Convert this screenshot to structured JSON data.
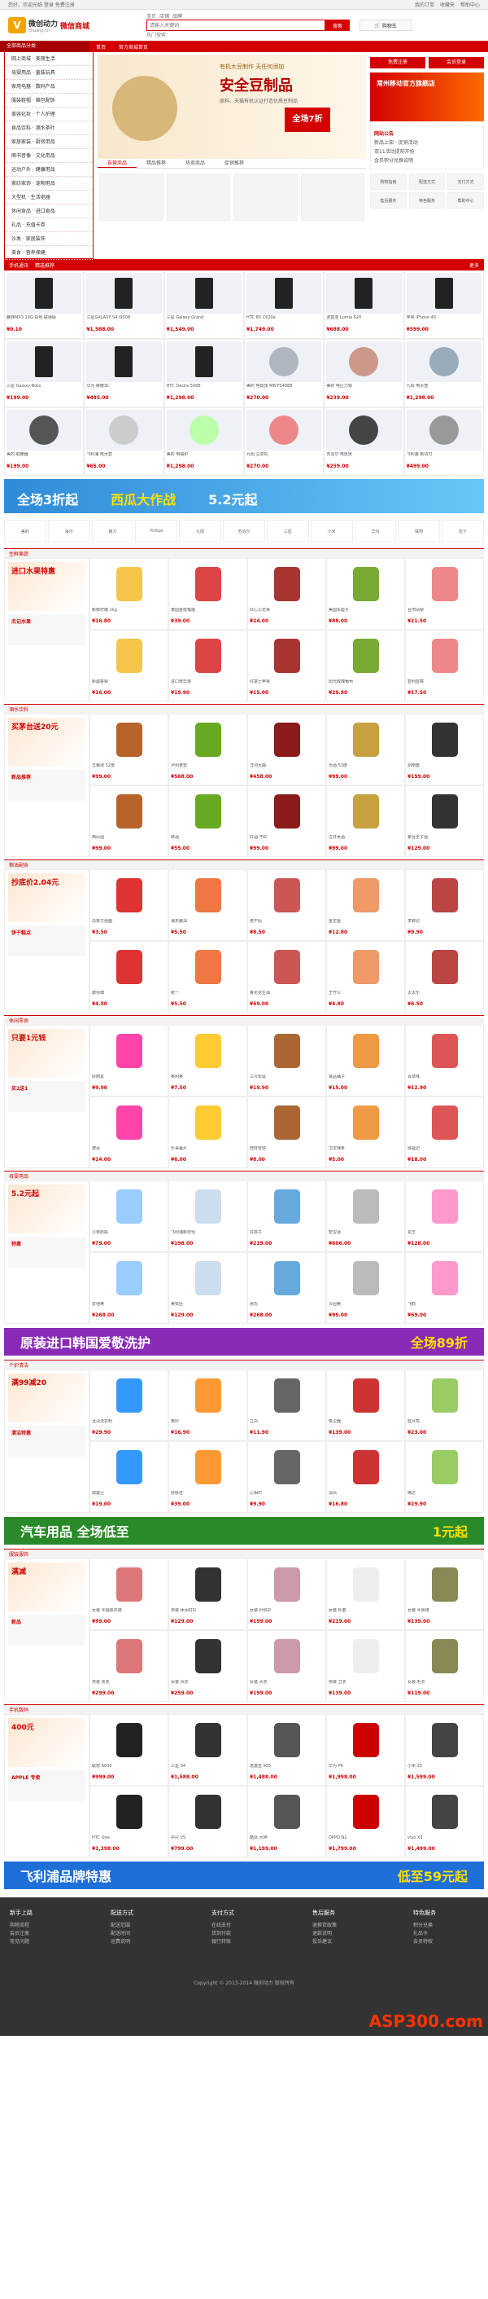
{
  "topbar": {
    "welcome": "您好，欢迎光临",
    "login": "登录",
    "register": "免费注册",
    "links": [
      "我的订单",
      "收藏夹",
      "帮助中心"
    ]
  },
  "header": {
    "logo": "微创动力",
    "sub": "微信商城",
    "domain": "chuang.cn",
    "search_tabs": [
      "宝贝",
      "店铺",
      "品牌"
    ],
    "search_placeholder": "请输入关键词",
    "search_button": "搜索",
    "hot": "热门搜索：",
    "cart": "购物车"
  },
  "nav": {
    "category": "全部商品分类",
    "links": [
      "首页",
      "官方商城首页"
    ]
  },
  "categories": [
    "网上商城 · 美丽生活",
    "母婴用品 · 童装玩具",
    "家用电器 · 数码产品",
    "服装鞋帽 · 箱包配饰",
    "美容化妆 · 个人护理",
    "食品饮料 · 酒水茶叶",
    "家居家装 · 厨房用品",
    "图书音像 · 文化用品",
    "运动户外 · 健康用品",
    "家纺家饰 · 宠物用品",
    "大型机 · 生活电器",
    "休闲食品 · 进口食品",
    "礼品 · 充值卡券",
    "沙发 · 家居装饰",
    "美食 · 营养保健"
  ],
  "banner": {
    "line1": "有机大豆制作 无任何添加",
    "title": "安全豆制品",
    "line3": "原料、天猫有机认证打造优质豆制品",
    "badge": "全场7折"
  },
  "minitabs": [
    "自营商品",
    "精品推荐",
    "热卖商品",
    "促销推荐"
  ],
  "right": {
    "btn1": "免费注册",
    "btn2": "会员登录",
    "promo": "常州移动官方旗舰店",
    "notice": [
      "网站公告",
      "新品上架 · 促销活动",
      "双11活动提前开抢",
      "会员积分兑换说明"
    ],
    "q": [
      "购物指南",
      "配送方式",
      "支付方式",
      "售后服务",
      "特色服务",
      "帮助中心"
    ]
  },
  "sec1": {
    "title": "手机通讯",
    "tabs": [
      "精选推荐"
    ],
    "more": "更多"
  },
  "products": [
    {
      "name": "魅族MX3 16G 白色 联通版",
      "price": "¥0.10"
    },
    {
      "name": "三星GALAXY S4 I9508",
      "price": "¥1,588.00"
    },
    {
      "name": "三星 Galaxy Grand",
      "price": "¥1,549.00"
    },
    {
      "name": "HTC 8X C620e",
      "price": "¥1,749.00"
    },
    {
      "name": "诺基亚 Lumia 620",
      "price": "¥688.00"
    },
    {
      "name": "苹果 iPhone 4S",
      "price": "¥599.00"
    },
    {
      "name": "三星 Galaxy Note",
      "price": "¥199.00"
    },
    {
      "name": "华为 荣耀3C",
      "price": "¥495.00"
    },
    {
      "name": "HTC Desire 5088",
      "price": "¥1,298.00"
    },
    {
      "name": "美的 电饭煲 MB-FS4088",
      "price": "¥270.00"
    },
    {
      "name": "美的 电压力锅",
      "price": "¥239.00"
    },
    {
      "name": "九阳 电水壶",
      "price": "¥1,298.00"
    },
    {
      "name": "美的 取暖器",
      "price": "¥199.00"
    },
    {
      "name": "飞利浦 电水壶",
      "price": "¥65.00"
    },
    {
      "name": "美的 电磁炉",
      "price": "¥1,298.00"
    },
    {
      "name": "九阳 豆浆机",
      "price": "¥270.00"
    },
    {
      "name": "苏泊尔 电饭煲",
      "price": "¥259.00"
    },
    {
      "name": "飞利浦 剃须刀",
      "price": "¥499.00"
    }
  ],
  "banner2": {
    "a": "全场3折起",
    "b": "西瓜大作战",
    "c": "5.2元起"
  },
  "brands": [
    "美的",
    "海尔",
    "格力",
    "Philips",
    "九阳",
    "苏泊尔",
    "三星",
    "小米",
    "华为",
    "联想",
    "松下"
  ],
  "fruit": {
    "title": "生鲜果蔬",
    "big": "进口水果特惠",
    "sm1": "杰记水果",
    "items": [
      {
        "name": "新鲜柠檬 1kg",
        "price": "¥16.80"
      },
      {
        "name": "泰国金枕榴莲",
        "price": "¥39.00"
      },
      {
        "name": "红心火龙果",
        "price": "¥24.00"
      },
      {
        "name": "美国车厘子",
        "price": "¥88.00"
      },
      {
        "name": "台湾凤梨",
        "price": "¥21.50"
      },
      {
        "name": "新疆香梨",
        "price": "¥16.00"
      },
      {
        "name": "进口奇异果",
        "price": "¥19.90"
      },
      {
        "name": "红富士苹果",
        "price": "¥15.00"
      },
      {
        "name": "阳光玫瑰葡萄",
        "price": "¥29.90"
      },
      {
        "name": "智利蓝莓",
        "price": "¥17.50"
      }
    ]
  },
  "wine": {
    "title": "酒水饮料",
    "big": "买茅台送20元",
    "sm1": "新品推荐",
    "items": [
      {
        "name": "五粮液 52度",
        "price": "¥99.00"
      },
      {
        "name": "泸州老窖",
        "price": "¥568.00"
      },
      {
        "name": "洋河大曲",
        "price": "¥458.00"
      },
      {
        "name": "汾酒 53度",
        "price": "¥99.00"
      },
      {
        "name": "剑南春",
        "price": "¥159.00"
      },
      {
        "name": "西凤酒",
        "price": "¥99.00"
      },
      {
        "name": "郎酒",
        "price": "¥55.00"
      },
      {
        "name": "红酒 干红",
        "price": "¥99.00"
      },
      {
        "name": "古井贡酒",
        "price": "¥99.00"
      },
      {
        "name": "茅台王子酒",
        "price": "¥129.00"
      }
    ]
  },
  "food": {
    "title": "粮油副食",
    "big": "抄底价2.04元",
    "sm1": "饼干糕点",
    "items": [
      {
        "name": "白象方便面",
        "price": "¥3.50"
      },
      {
        "name": "海天酱油",
        "price": "¥5.50"
      },
      {
        "name": "老干妈",
        "price": "¥8.50"
      },
      {
        "name": "金龙鱼",
        "price": "¥12.80"
      },
      {
        "name": "李锦记",
        "price": "¥9.90"
      },
      {
        "name": "康师傅",
        "price": "¥4.50"
      },
      {
        "name": "统一",
        "price": "¥5.50"
      },
      {
        "name": "鲁花花生油",
        "price": "¥69.00"
      },
      {
        "name": "王守义",
        "price": "¥4.80"
      },
      {
        "name": "太太乐",
        "price": "¥6.50"
      }
    ]
  },
  "snack": {
    "title": "休闲零食",
    "big": "只要1元钱",
    "sm1": "买2送1",
    "items": [
      {
        "name": "好丽友",
        "price": "¥9.90"
      },
      {
        "name": "奥利奥",
        "price": "¥7.50"
      },
      {
        "name": "三只松鼠",
        "price": "¥19.90"
      },
      {
        "name": "良品铺子",
        "price": "¥15.00"
      },
      {
        "name": "百草味",
        "price": "¥12.90"
      },
      {
        "name": "德芙",
        "price": "¥14.00"
      },
      {
        "name": "乐事薯片",
        "price": "¥6.00"
      },
      {
        "name": "旺旺雪饼",
        "price": "¥8.00"
      },
      {
        "name": "卫龙辣条",
        "price": "¥5.00"
      },
      {
        "name": "徐福记",
        "price": "¥18.00"
      }
    ]
  },
  "mom": {
    "title": "母婴用品",
    "big": "5.2元起",
    "sm1": "特惠",
    "items": [
      {
        "name": "贝亲奶瓶",
        "price": "¥79.00"
      },
      {
        "name": "飞利浦新安怡",
        "price": "¥198.00"
      },
      {
        "name": "好孩子",
        "price": "¥219.00"
      },
      {
        "name": "帮宝适",
        "price": "¥606.00"
      },
      {
        "name": "花王",
        "price": "¥128.00"
      },
      {
        "name": "爱他美",
        "price": "¥268.00"
      },
      {
        "name": "美赞臣",
        "price": "¥129.00"
      },
      {
        "name": "惠氏",
        "price": "¥268.00"
      },
      {
        "name": "贝因美",
        "price": "¥99.00"
      },
      {
        "name": "飞鹤",
        "price": "¥69.00"
      }
    ]
  },
  "banner3": {
    "a": "原装进口韩国爱敬洗护",
    "b": "全场89折"
  },
  "clean": {
    "title": "个护清洁",
    "big": "满99减20",
    "sm1": "清洁特惠",
    "items": [
      {
        "name": "汰渍洗衣粉",
        "price": "¥29.90"
      },
      {
        "name": "奥妙",
        "price": "¥16.90"
      },
      {
        "name": "立白",
        "price": "¥11.90"
      },
      {
        "name": "吸尘器",
        "price": "¥139.00"
      },
      {
        "name": "蓝月亮",
        "price": "¥23.00"
      },
      {
        "name": "威露士",
        "price": "¥19.00"
      },
      {
        "name": "舒肤佳",
        "price": "¥39.00"
      },
      {
        "name": "心相印",
        "price": "¥9.90"
      },
      {
        "name": "清风",
        "price": "¥16.80"
      },
      {
        "name": "维达",
        "price": "¥29.90"
      }
    ]
  },
  "banner4": {
    "a": "汽车用品 全场低至",
    "b": "1元起"
  },
  "fashion": {
    "title": "服装服饰",
    "big": "满减",
    "sm1": "新品",
    "items": [
      {
        "name": "女装 长袖连衣裙",
        "price": "¥99.00"
      },
      {
        "name": "男装 休闲衬衫",
        "price": "¥129.00"
      },
      {
        "name": "女装 针织衫",
        "price": "¥199.00"
      },
      {
        "name": "女装 外套",
        "price": "¥219.00"
      },
      {
        "name": "女装 半身裙",
        "price": "¥139.00"
      },
      {
        "name": "男装 夹克",
        "price": "¥299.00"
      },
      {
        "name": "女装 风衣",
        "price": "¥259.00"
      },
      {
        "name": "女装 大衣",
        "price": "¥199.00"
      },
      {
        "name": "男装 卫衣",
        "price": "¥139.00"
      },
      {
        "name": "女装 毛衣",
        "price": "¥119.00"
      }
    ]
  },
  "phone2": {
    "title": "手机数码",
    "big": "400元",
    "sm1": "APPLE 专卖",
    "items": [
      {
        "name": "联想 A830",
        "price": "¥999.00"
      },
      {
        "name": "三星 S4",
        "price": "¥1,588.00"
      },
      {
        "name": "诺基亚 925",
        "price": "¥1,488.00"
      },
      {
        "name": "华为 P6",
        "price": "¥1,998.00"
      },
      {
        "name": "小米 2S",
        "price": "¥1,599.00"
      },
      {
        "name": "HTC One",
        "price": "¥1,398.00"
      },
      {
        "name": "中兴 V5",
        "price": "¥799.00"
      },
      {
        "name": "酷派 大神",
        "price": "¥1,199.00"
      },
      {
        "name": "OPPO N1",
        "price": "¥1,799.00"
      },
      {
        "name": "vivo X3",
        "price": "¥1,499.00"
      }
    ]
  },
  "banner5": {
    "a": "飞利浦品牌特惠",
    "b": "低至59元起"
  },
  "footer": {
    "cols": [
      {
        "h": "新手上路",
        "items": [
          "购物流程",
          "会员注册",
          "常见问题"
        ]
      },
      {
        "h": "配送方式",
        "items": [
          "配送范围",
          "配送时间",
          "运费说明"
        ]
      },
      {
        "h": "支付方式",
        "items": [
          "在线支付",
          "货到付款",
          "银行转账"
        ]
      },
      {
        "h": "售后服务",
        "items": [
          "退换货政策",
          "退款说明",
          "投诉建议"
        ]
      },
      {
        "h": "特色服务",
        "items": [
          "积分兑换",
          "礼品卡",
          "会员特权"
        ]
      }
    ],
    "copy": "Copyright © 2013-2014 微创动力 版权所有",
    "watermark": "ASP300.com"
  }
}
